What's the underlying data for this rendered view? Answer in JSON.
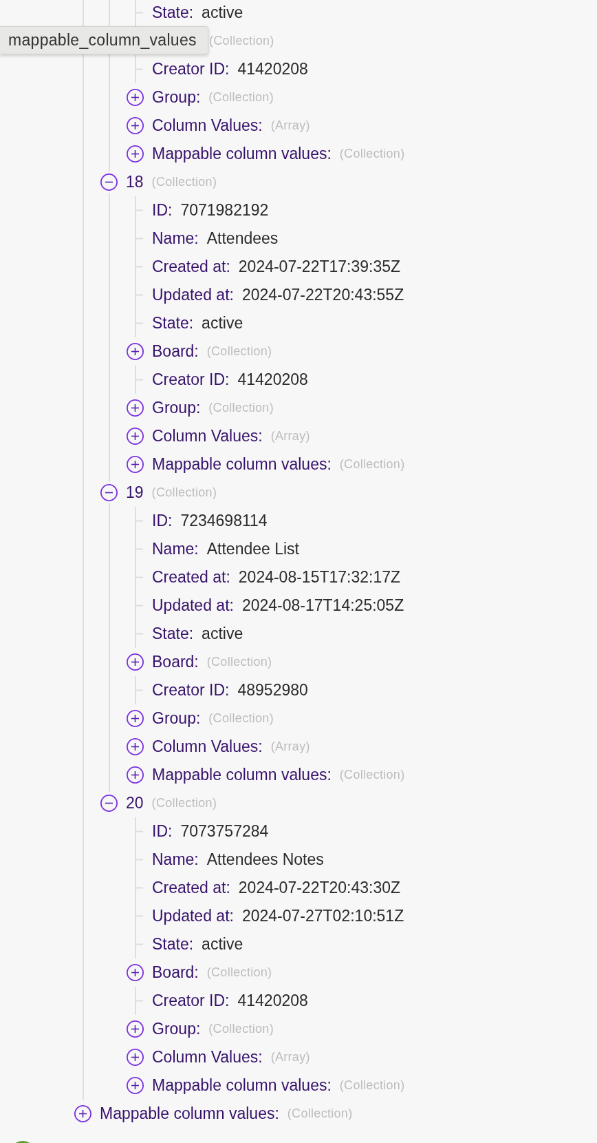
{
  "tooltip": {
    "text": "mappable_column_values"
  },
  "tree": {
    "children": [
      {
        "kind": "branch",
        "children": [
          {
            "kind": "branch",
            "children": [
              {
                "kind": "leaf",
                "label": "State:",
                "value": "active"
              },
              {
                "kind": "branch",
                "hint": "(Collection)"
              },
              {
                "kind": "leaf",
                "label": "Creator ID:",
                "value": "41420208"
              },
              {
                "kind": "branch",
                "label": "Group:",
                "hint": "(Collection)",
                "expanded": false
              },
              {
                "kind": "branch",
                "label": "Column Values:",
                "hint": "(Array)",
                "expanded": false
              },
              {
                "kind": "branch",
                "label": "Mappable column values:",
                "hint": "(Collection)",
                "expanded": false
              }
            ]
          },
          {
            "kind": "branch",
            "label": "18",
            "hint": "(Collection)",
            "expanded": true,
            "children": [
              {
                "kind": "leaf",
                "label": "ID:",
                "value": "7071982192"
              },
              {
                "kind": "leaf",
                "label": "Name:",
                "value": "Attendees"
              },
              {
                "kind": "leaf",
                "label": "Created at:",
                "value": "2024-07-22T17:39:35Z"
              },
              {
                "kind": "leaf",
                "label": "Updated at:",
                "value": "2024-07-22T20:43:55Z"
              },
              {
                "kind": "leaf",
                "label": "State:",
                "value": "active"
              },
              {
                "kind": "branch",
                "label": "Board:",
                "hint": "(Collection)",
                "expanded": false
              },
              {
                "kind": "leaf",
                "label": "Creator ID:",
                "value": "41420208"
              },
              {
                "kind": "branch",
                "label": "Group:",
                "hint": "(Collection)",
                "expanded": false
              },
              {
                "kind": "branch",
                "label": "Column Values:",
                "hint": "(Array)",
                "expanded": false
              },
              {
                "kind": "branch",
                "label": "Mappable column values:",
                "hint": "(Collection)",
                "expanded": false
              }
            ]
          },
          {
            "kind": "branch",
            "label": "19",
            "hint": "(Collection)",
            "expanded": true,
            "children": [
              {
                "kind": "leaf",
                "label": "ID:",
                "value": "7234698114"
              },
              {
                "kind": "leaf",
                "label": "Name:",
                "value": "Attendee List"
              },
              {
                "kind": "leaf",
                "label": "Created at:",
                "value": "2024-08-15T17:32:17Z"
              },
              {
                "kind": "leaf",
                "label": "Updated at:",
                "value": "2024-08-17T14:25:05Z"
              },
              {
                "kind": "leaf",
                "label": "State:",
                "value": "active"
              },
              {
                "kind": "branch",
                "label": "Board:",
                "hint": "(Collection)",
                "expanded": false
              },
              {
                "kind": "leaf",
                "label": "Creator ID:",
                "value": "48952980"
              },
              {
                "kind": "branch",
                "label": "Group:",
                "hint": "(Collection)",
                "expanded": false
              },
              {
                "kind": "branch",
                "label": "Column Values:",
                "hint": "(Array)",
                "expanded": false
              },
              {
                "kind": "branch",
                "label": "Mappable column values:",
                "hint": "(Collection)",
                "expanded": false
              }
            ]
          },
          {
            "kind": "branch",
            "label": "20",
            "hint": "(Collection)",
            "expanded": true,
            "children": [
              {
                "kind": "leaf",
                "label": "ID:",
                "value": "7073757284"
              },
              {
                "kind": "leaf",
                "label": "Name:",
                "value": "Attendees Notes"
              },
              {
                "kind": "leaf",
                "label": "Created at:",
                "value": "2024-07-22T20:43:30Z"
              },
              {
                "kind": "leaf",
                "label": "Updated at:",
                "value": "2024-07-27T02:10:51Z"
              },
              {
                "kind": "leaf",
                "label": "State:",
                "value": "active"
              },
              {
                "kind": "branch",
                "label": "Board:",
                "hint": "(Collection)",
                "expanded": false
              },
              {
                "kind": "leaf",
                "label": "Creator ID:",
                "value": "41420208"
              },
              {
                "kind": "branch",
                "label": "Group:",
                "hint": "(Collection)",
                "expanded": false
              },
              {
                "kind": "branch",
                "label": "Column Values:",
                "hint": "(Array)",
                "expanded": false
              },
              {
                "kind": "branch",
                "label": "Mappable column values:",
                "hint": "(Collection)",
                "expanded": false
              }
            ]
          }
        ]
      },
      {
        "kind": "branch",
        "label": "Mappable column values:",
        "hint": "(Collection)",
        "expanded": false
      }
    ]
  }
}
